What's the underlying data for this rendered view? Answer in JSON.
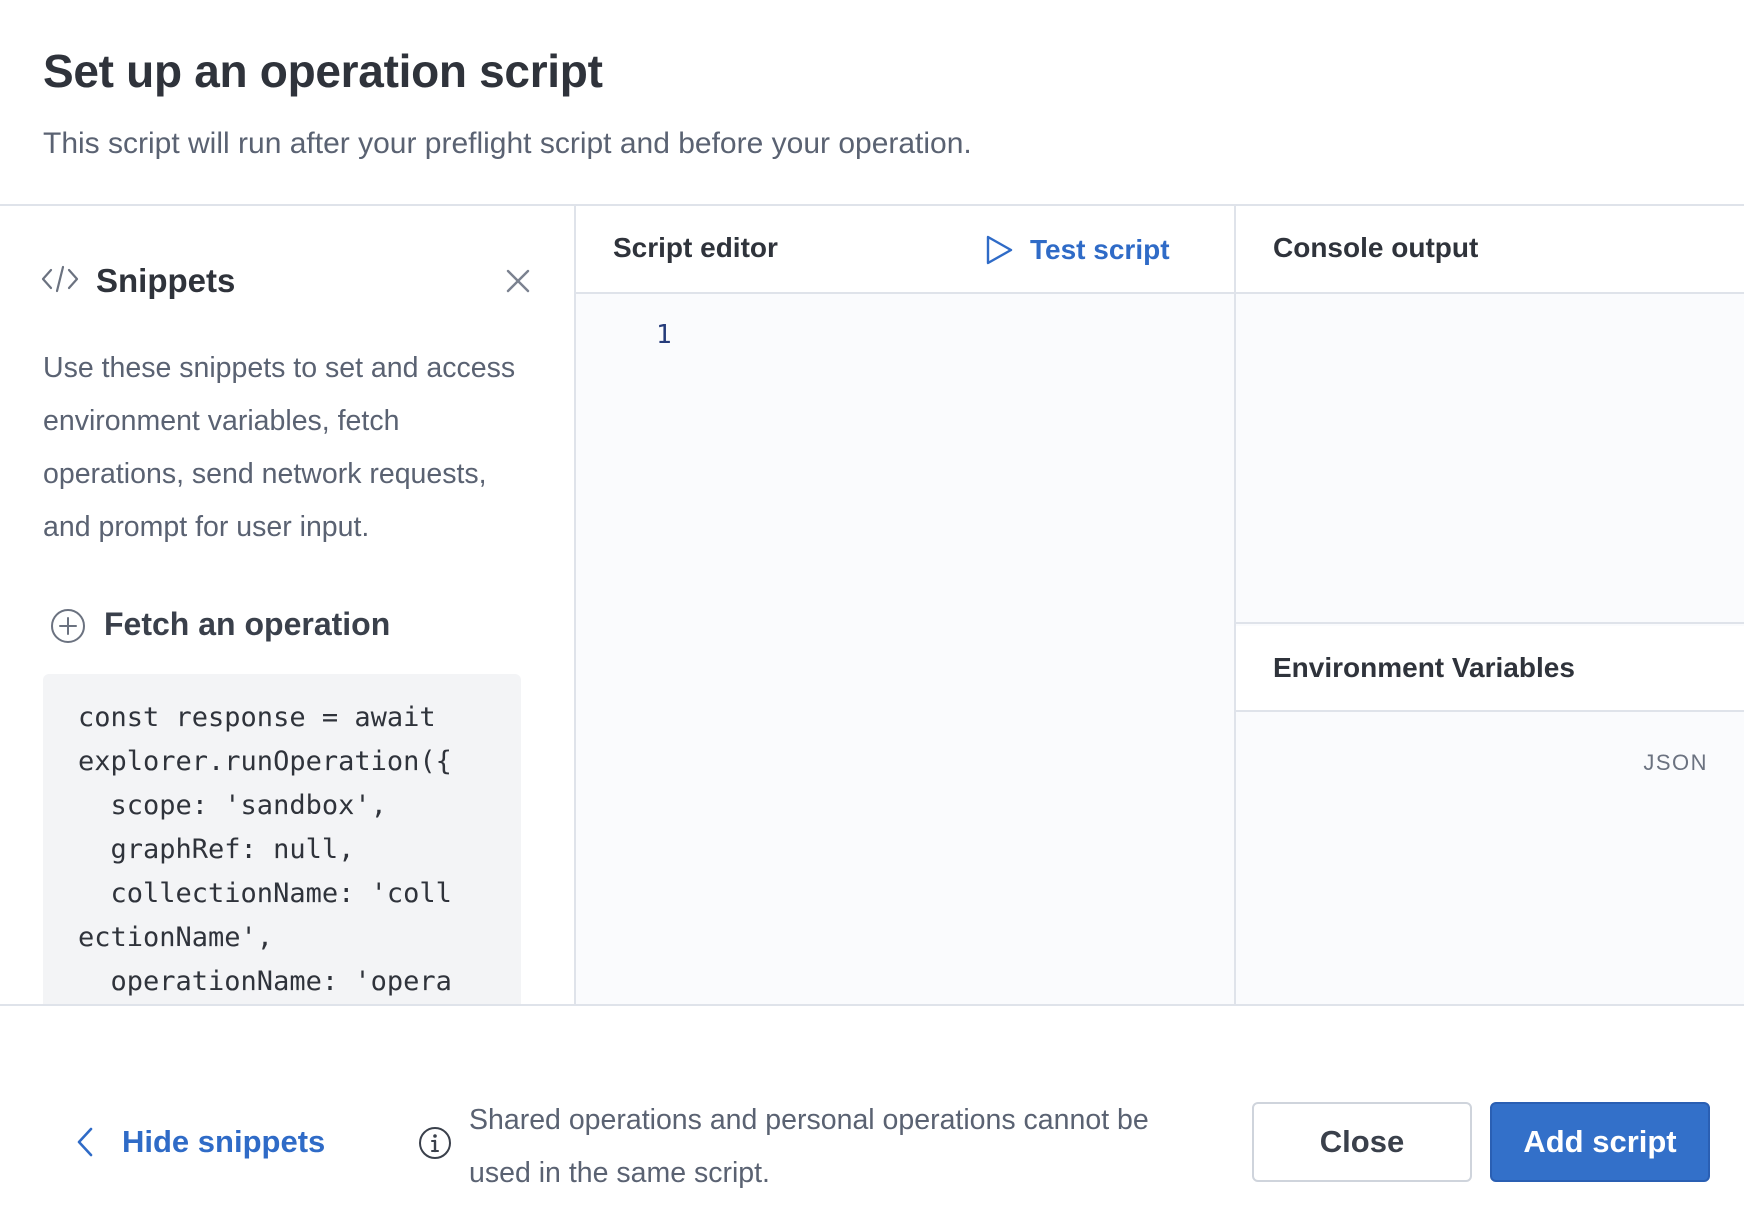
{
  "dialog": {
    "title": "Set up an operation script",
    "subtitle": "This script will run after your preflight script and before your operation."
  },
  "snippets": {
    "icon": "code-icon",
    "title": "Snippets",
    "close_icon": "close-icon",
    "description": "Use these snippets to set and access environment variables, fetch operations, send network requests, and prompt for user input.",
    "items": [
      {
        "icon": "plus-circle-icon",
        "title": "Fetch an operation",
        "code": "const response = await\nexplorer.runOperation({\n  scope: 'sandbox',\n  graphRef: null,\n  collectionName: 'coll\nectionName',\n  operationName: 'opera"
      }
    ]
  },
  "editor": {
    "title": "Script editor",
    "test_icon": "play-icon",
    "test_label": "Test script",
    "line_numbers": [
      "1"
    ]
  },
  "console": {
    "title": "Console output"
  },
  "environment": {
    "title": "Environment Variables",
    "format_tag": "JSON"
  },
  "footer": {
    "hide_icon": "chevron-left-icon",
    "hide_label": "Hide snippets",
    "info_icon": "info-icon",
    "notice": "Shared operations and personal operations cannot be used in the same script.",
    "close_label": "Close",
    "add_label": "Add script"
  },
  "colors": {
    "accent": "#2f6bc7",
    "primary_button": "#3370c9",
    "border": "#dfe3ea",
    "panel_bg": "#fafbfd"
  }
}
